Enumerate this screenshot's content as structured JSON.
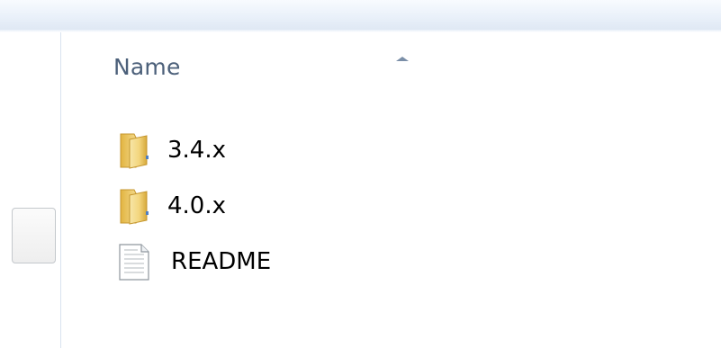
{
  "column_header": {
    "name_label": "Name",
    "sort": "ascending"
  },
  "files": [
    {
      "name": "3.4.x",
      "type": "folder",
      "icon": "folder-icon"
    },
    {
      "name": "4.0.x",
      "type": "folder",
      "icon": "folder-icon"
    },
    {
      "name": "README",
      "type": "file",
      "icon": "text-document-icon"
    }
  ],
  "colors": {
    "header_text": "#4c607a",
    "folder": "#e9c25a",
    "band": "#eaf1fa"
  }
}
